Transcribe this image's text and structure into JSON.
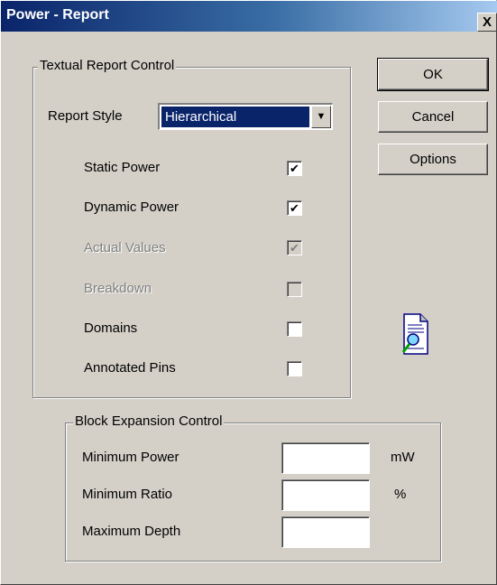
{
  "window": {
    "title": "Power - Report",
    "close_glyph": "X"
  },
  "buttons": {
    "ok": "OK",
    "cancel": "Cancel",
    "options": "Options"
  },
  "textual_report": {
    "group_label": "Textual Report Control",
    "report_style_label": "Report Style",
    "report_style_value": "Hierarchical",
    "dropdown_arrow": "▼",
    "options": [
      {
        "label": "Static Power",
        "checked": true,
        "enabled": true,
        "mark": "✔"
      },
      {
        "label": "Dynamic Power",
        "checked": true,
        "enabled": true,
        "mark": "✔"
      },
      {
        "label": "Actual Values",
        "checked": true,
        "enabled": false,
        "mark": "✔"
      },
      {
        "label": "Breakdown",
        "checked": false,
        "enabled": false,
        "mark": ""
      },
      {
        "label": "Domains",
        "checked": false,
        "enabled": true,
        "mark": ""
      },
      {
        "label": "Annotated Pins",
        "checked": false,
        "enabled": true,
        "mark": ""
      }
    ]
  },
  "block_expansion": {
    "group_label": "Block Expansion Control",
    "minimum_power_label": "Minimum Power",
    "minimum_power_value": "",
    "minimum_power_unit": "mW",
    "minimum_ratio_label": "Minimum Ratio",
    "minimum_ratio_value": "",
    "minimum_ratio_unit": "%",
    "maximum_depth_label": "Maximum Depth",
    "maximum_depth_value": ""
  },
  "icons": {
    "report": "report-magnifier-icon"
  },
  "colors": {
    "titlebar_start": "#0a246a",
    "titlebar_end": "#a6caf0",
    "dialog_face": "#d4d0c8",
    "selection": "#0a246a"
  }
}
